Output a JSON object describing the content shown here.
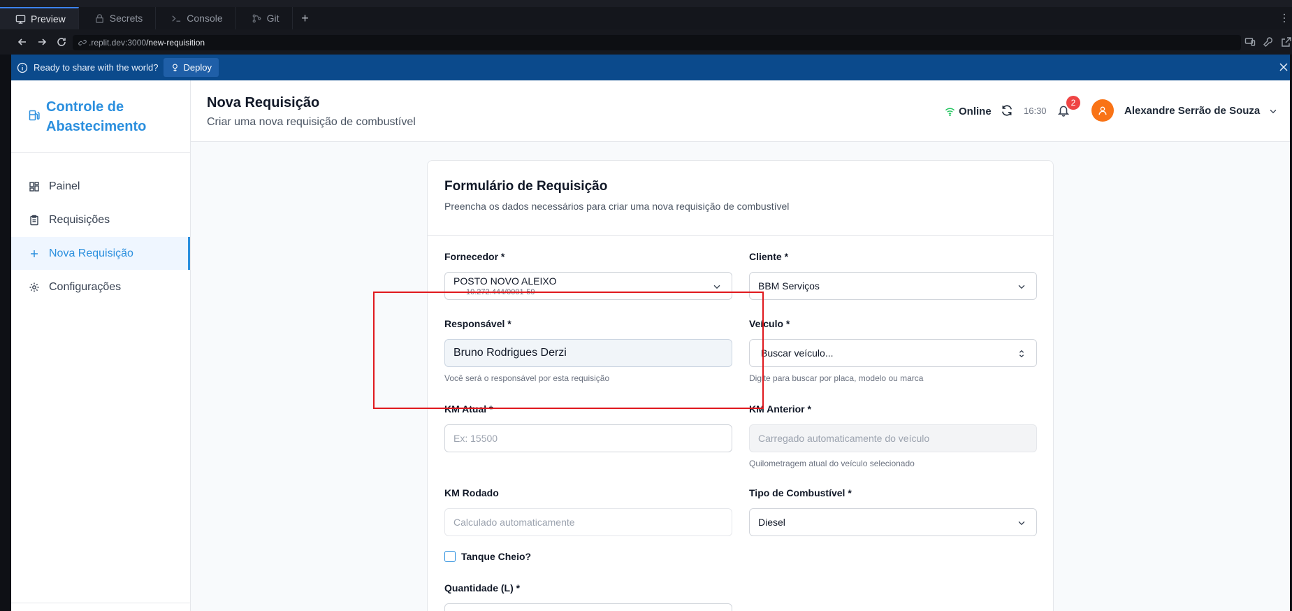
{
  "replit": {
    "tabs": [
      {
        "label": "Preview",
        "icon": "monitor-icon"
      },
      {
        "label": "Secrets",
        "icon": "lock-icon"
      },
      {
        "label": "Console",
        "icon": "terminal-icon"
      },
      {
        "label": "Git",
        "icon": "git-icon"
      }
    ],
    "add_tab": "+",
    "url_host": ".replit.dev:3000",
    "url_path": "/new-requisition",
    "banner_message": "Ready to share with the world?",
    "deploy_label": "Deploy"
  },
  "sidebar": {
    "brand": "Controle de Abastecimento",
    "items": [
      {
        "label": "Painel",
        "icon": "dashboard-icon"
      },
      {
        "label": "Requisições",
        "icon": "clipboard-icon"
      },
      {
        "label": "Nova Requisição",
        "icon": "plus-icon",
        "active": true
      },
      {
        "label": "Configurações",
        "icon": "gear-icon"
      }
    ]
  },
  "header": {
    "title": "Nova Requisição",
    "subtitle": "Criar uma nova requisição de combustível",
    "status": "Online",
    "time": "16:30",
    "notifications": "2",
    "user": "Alexandre Serrão de Souza"
  },
  "form": {
    "title": "Formulário de Requisição",
    "description": "Preencha os dados necessários para criar uma nova requisição de combustível",
    "fornecedor": {
      "label": "Fornecedor *",
      "value": "POSTO NOVO ALEIXO",
      "sub": "10.272.444/0001-59"
    },
    "cliente": {
      "label": "Cliente *",
      "value": "BBM Serviços"
    },
    "responsavel": {
      "label": "Responsável *",
      "value": "Bruno Rodrigues Derzi",
      "hint": "Você será o responsável por esta requisição"
    },
    "veiculo": {
      "label": "Veículo *",
      "placeholder": "Buscar veículo...",
      "hint": "Digite para buscar por placa, modelo ou marca"
    },
    "km_atual": {
      "label": "KM Atual *",
      "placeholder": "Ex: 15500"
    },
    "km_anterior": {
      "label": "KM Anterior *",
      "placeholder": "Carregado automaticamente do veículo",
      "hint": "Quilometragem atual do veículo selecionado"
    },
    "km_rodado": {
      "label": "KM Rodado",
      "placeholder": "Calculado automaticamente"
    },
    "combustivel": {
      "label": "Tipo de Combustível *",
      "value": "Diesel"
    },
    "tanque_cheio": {
      "label": "Tanque Cheio?",
      "checked": false
    },
    "quantidade": {
      "label": "Quantidade (L) *"
    }
  },
  "colors": {
    "accent": "#2b8fde",
    "banner": "#0b4a8c",
    "avatar": "#f97316",
    "badge": "#ef4444",
    "online": "#22c55e",
    "highlight": "#e0191e"
  }
}
